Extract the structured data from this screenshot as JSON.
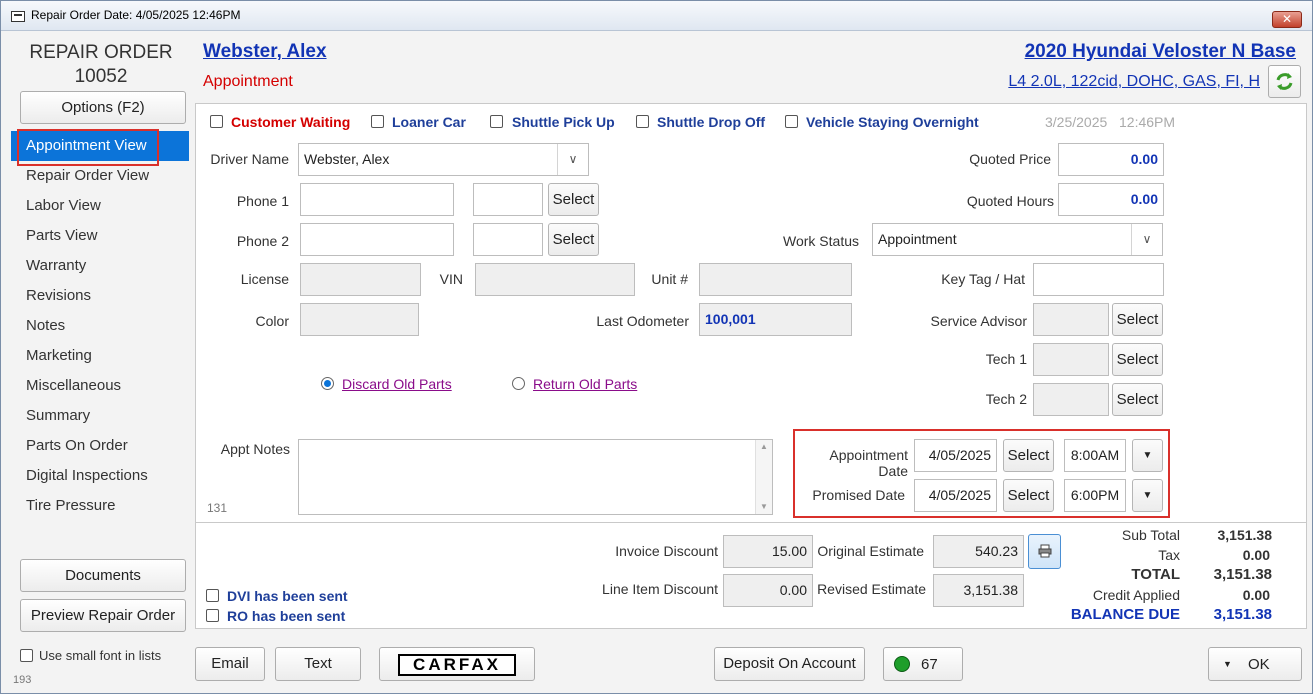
{
  "window": {
    "title": "Repair Order Date:  4/05/2025  12:46PM",
    "close_glyph": "✕"
  },
  "left": {
    "ro_label": "REPAIR ORDER",
    "ro_number": "10052",
    "options_label": "Options (F2)",
    "nav": [
      "Appointment View",
      "Repair Order View",
      "Labor View",
      "Parts View",
      "Warranty",
      "Revisions",
      "Notes",
      "Marketing",
      "Miscellaneous",
      "Summary",
      "Parts On Order",
      "Digital Inspections",
      "Tire Pressure"
    ],
    "documents_label": "Documents",
    "preview_label": "Preview Repair Order",
    "small_font_label": "Use small font in lists",
    "footer_number": "193"
  },
  "header": {
    "customer": "Webster, Alex",
    "status": "Appointment",
    "vehicle": "2020 Hyundai  Veloster N Base",
    "engine": "L4 2.0L, 122cid, DOHC, GAS, FI, H",
    "refresh_icon": "refresh-icon"
  },
  "options_row": {
    "customer_waiting": "Customer Waiting",
    "loaner_car": "Loaner Car",
    "shuttle_pick_up": "Shuttle Pick Up",
    "shuttle_drop_off": "Shuttle Drop Off",
    "vehicle_overnight": "Vehicle Staying Overnight",
    "date": "3/25/2025",
    "time": "12:46PM"
  },
  "form": {
    "driver_name_label": "Driver Name",
    "driver_name_value": "Webster, Alex",
    "phone1_label": "Phone 1",
    "phone2_label": "Phone 2",
    "select_label": "Select",
    "license_label": "License",
    "vin_label": "VIN",
    "unit_label": "Unit #",
    "color_label": "Color",
    "last_odometer_label": "Last Odometer",
    "last_odometer_value": "100,001",
    "discard_old_parts": "Discard Old Parts",
    "return_old_parts": "Return Old Parts",
    "appt_notes_label": "Appt Notes",
    "notes_counter": "131",
    "quoted_price_label": "Quoted Price",
    "quoted_price_value": "0.00",
    "quoted_hours_label": "Quoted Hours",
    "quoted_hours_value": "0.00",
    "work_status_label": "Work Status",
    "work_status_value": "Appointment",
    "key_tag_label": "Key Tag / Hat",
    "service_advisor_label": "Service Advisor",
    "tech1_label": "Tech 1",
    "tech2_label": "Tech 2",
    "appointment_date_label": "Appointment Date",
    "appointment_date_value": "4/05/2025",
    "appointment_time_value": "8:00AM",
    "promised_date_label": "Promised Date",
    "promised_date_value": "4/05/2025",
    "promised_time_value": "6:00PM"
  },
  "totals": {
    "invoice_discount_label": "Invoice Discount",
    "invoice_discount_value": "15.00",
    "line_item_discount_label": "Line Item Discount",
    "line_item_discount_value": "0.00",
    "original_estimate_label": "Original Estimate",
    "original_estimate_value": "540.23",
    "revised_estimate_label": "Revised Estimate",
    "revised_estimate_value": "3,151.38",
    "dvi_sent_label": "DVI has been sent",
    "ro_sent_label": "RO has been sent",
    "sub_total_label": "Sub Total",
    "sub_total_value": "3,151.38",
    "tax_label": "Tax",
    "tax_value": "0.00",
    "total_label": "TOTAL",
    "total_value": "3,151.38",
    "credit_applied_label": "Credit Applied",
    "credit_applied_value": "0.00",
    "balance_due_label": "BALANCE DUE",
    "balance_due_value": "3,151.38"
  },
  "bottom": {
    "email_label": "Email",
    "text_label": "Text",
    "carfax_label": "CARFAX",
    "deposit_label": "Deposit On Account",
    "status_count": "67",
    "ok_label": "OK",
    "status_color": "#1e9e2a"
  }
}
